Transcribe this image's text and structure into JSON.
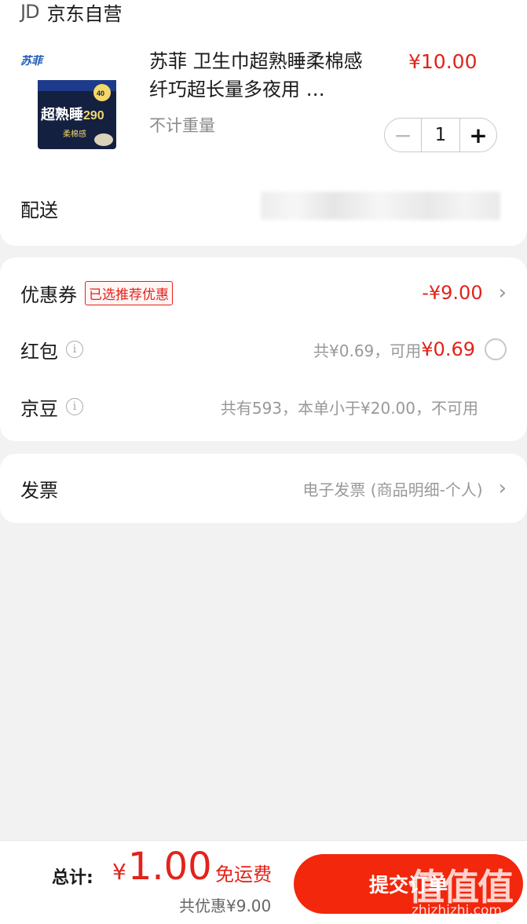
{
  "store": {
    "logo": "JD",
    "name": "京东自营"
  },
  "product": {
    "title": "苏菲 卫生巾超熟睡柔棉感纤巧超长量多夜用 …",
    "price": "¥10.00",
    "spec": "不计重量",
    "quantity": "1",
    "image": {
      "brand": "苏菲",
      "headline": "超熟睡",
      "length": "290",
      "badge": "40",
      "sub": "柔棉感"
    }
  },
  "delivery": {
    "label": "配送"
  },
  "discounts": {
    "coupon": {
      "label": "优惠券",
      "tag": "已选推荐优惠",
      "amount": "-¥9.00"
    },
    "redpacket": {
      "label": "红包",
      "info": "共¥0.69，可用",
      "amount": "¥0.69"
    },
    "jingdou": {
      "label": "京豆",
      "info": "共有593，本单小于¥20.00，不可用"
    }
  },
  "invoice": {
    "label": "发票",
    "value": "电子发票 (商品明细-个人)"
  },
  "footer": {
    "total_label": "总计:",
    "currency": "¥",
    "total": "1.00",
    "shipping": "免运费",
    "saved": "共优惠¥9.00",
    "submit": "提交订单"
  },
  "watermark": {
    "text": "值值值",
    "sub": "zhizhizhi.com"
  },
  "colors": {
    "accent": "#e2231a",
    "button": "#f2270c",
    "background": "#f2f2f2"
  },
  "icons": {
    "info": "info-icon",
    "chevron": "chevron-right-icon",
    "radio": "radio-unchecked"
  }
}
